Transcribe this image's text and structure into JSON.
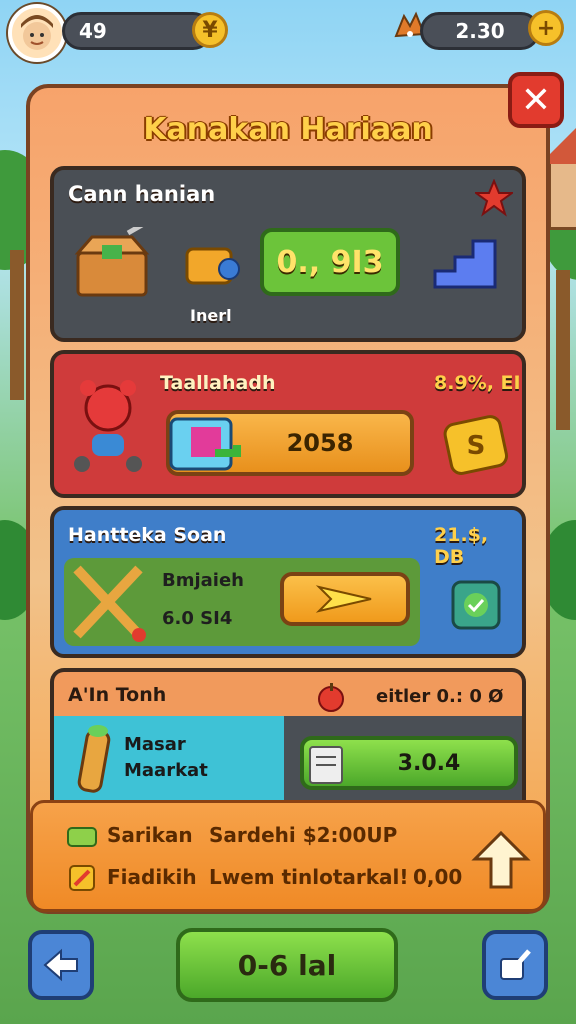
{
  "top_bar": {
    "level_value": "49",
    "currency_value": "2.30",
    "plus_symbol": "+",
    "badge_symbol": "¥"
  },
  "panel": {
    "title": "Kanakan Hariaan",
    "close_symbol": "✕"
  },
  "cards": [
    {
      "label": "Cann hanian",
      "sub_label": "Inerl",
      "value": "0., 9I3",
      "accent": "#4a4f55"
    },
    {
      "label": "Taallahadh",
      "corner_text": "8.9%, EI",
      "value": "2058",
      "accent": "#cf3b3b"
    },
    {
      "label": "Hantteka Soan",
      "corner_text": "21.$, DB",
      "line1": "Bmjaieh",
      "line2": "6.0 SI4",
      "accent": "#3f7ec9"
    },
    {
      "label": "A'In Tonh",
      "corner_text": "eitler 0.: 0 Ø",
      "line1": "Masar",
      "line2": "Maarkat",
      "value": "3.0.4",
      "accent": "#f19a5c"
    }
  ],
  "footer": {
    "row1_a": "Sarikan",
    "row1_b": "Sardehi $2:00UP",
    "row2_a": "Fiadikih",
    "row2_b": "Lwem tinlotarkal!",
    "row2_value": "0,00"
  },
  "bottom_nav": {
    "main_label": "0-6 lal"
  },
  "colors": {
    "title": "#ffd04a",
    "green_button": "#6cc43a",
    "orange_button": "#f6a23a",
    "close_red": "#e23b2e"
  }
}
